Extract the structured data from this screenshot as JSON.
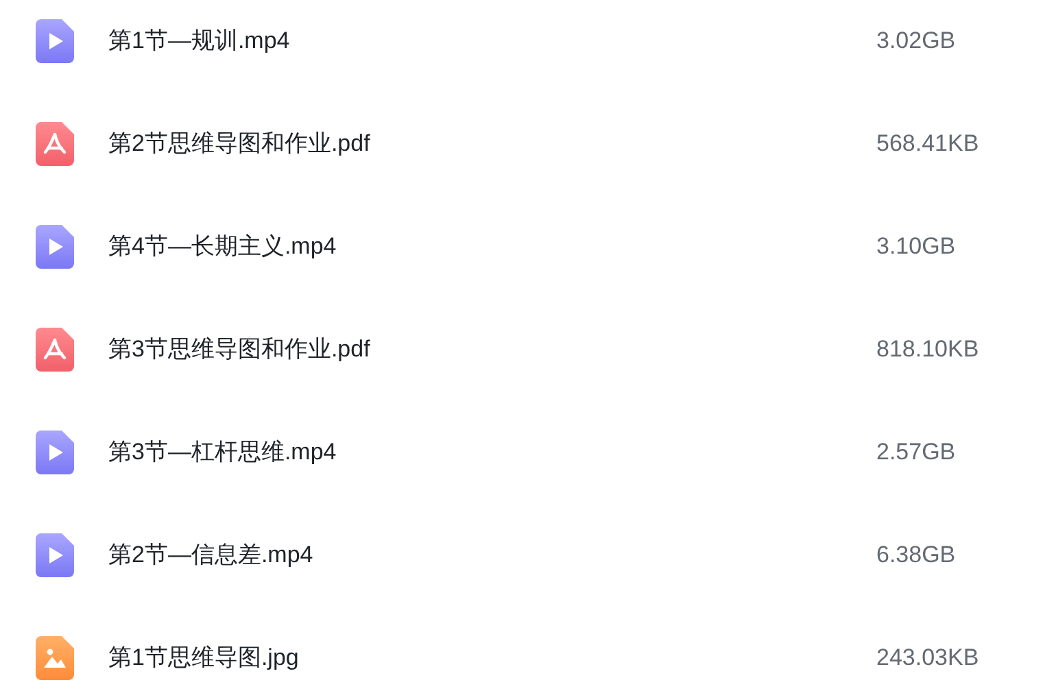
{
  "files": [
    {
      "kind": "video",
      "name": "第1节—规训.mp4",
      "size": "3.02GB"
    },
    {
      "kind": "pdf",
      "name": "第2节思维导图和作业.pdf",
      "size": "568.41KB"
    },
    {
      "kind": "video",
      "name": "第4节—长期主义.mp4",
      "size": "3.10GB"
    },
    {
      "kind": "pdf",
      "name": "第3节思维导图和作业.pdf",
      "size": "818.10KB"
    },
    {
      "kind": "video",
      "name": "第3节—杠杆思维.mp4",
      "size": "2.57GB"
    },
    {
      "kind": "video",
      "name": "第2节—信息差.mp4",
      "size": "6.38GB"
    },
    {
      "kind": "image",
      "name": "第1节思维导图.jpg",
      "size": "243.03KB"
    }
  ]
}
